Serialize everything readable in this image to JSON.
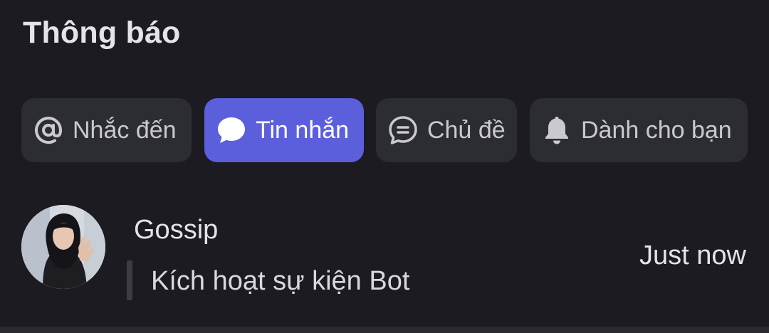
{
  "header": {
    "title": "Thông báo"
  },
  "tabs": [
    {
      "label": "Nhắc đến",
      "icon": "at-icon",
      "active": false
    },
    {
      "label": "Tin nhắn",
      "icon": "chat-bubble-icon",
      "active": true
    },
    {
      "label": "Chủ đề",
      "icon": "thread-icon",
      "active": false
    },
    {
      "label": "Dành cho bạn",
      "icon": "bell-icon",
      "active": false
    }
  ],
  "notifications": [
    {
      "sender": "Gossip",
      "message": "Kích hoạt sự kiện Bot",
      "time": "Just now"
    }
  ],
  "colors": {
    "background": "#1c1b21",
    "tab_background": "#2c2c33",
    "accent": "#5c5fdc"
  }
}
